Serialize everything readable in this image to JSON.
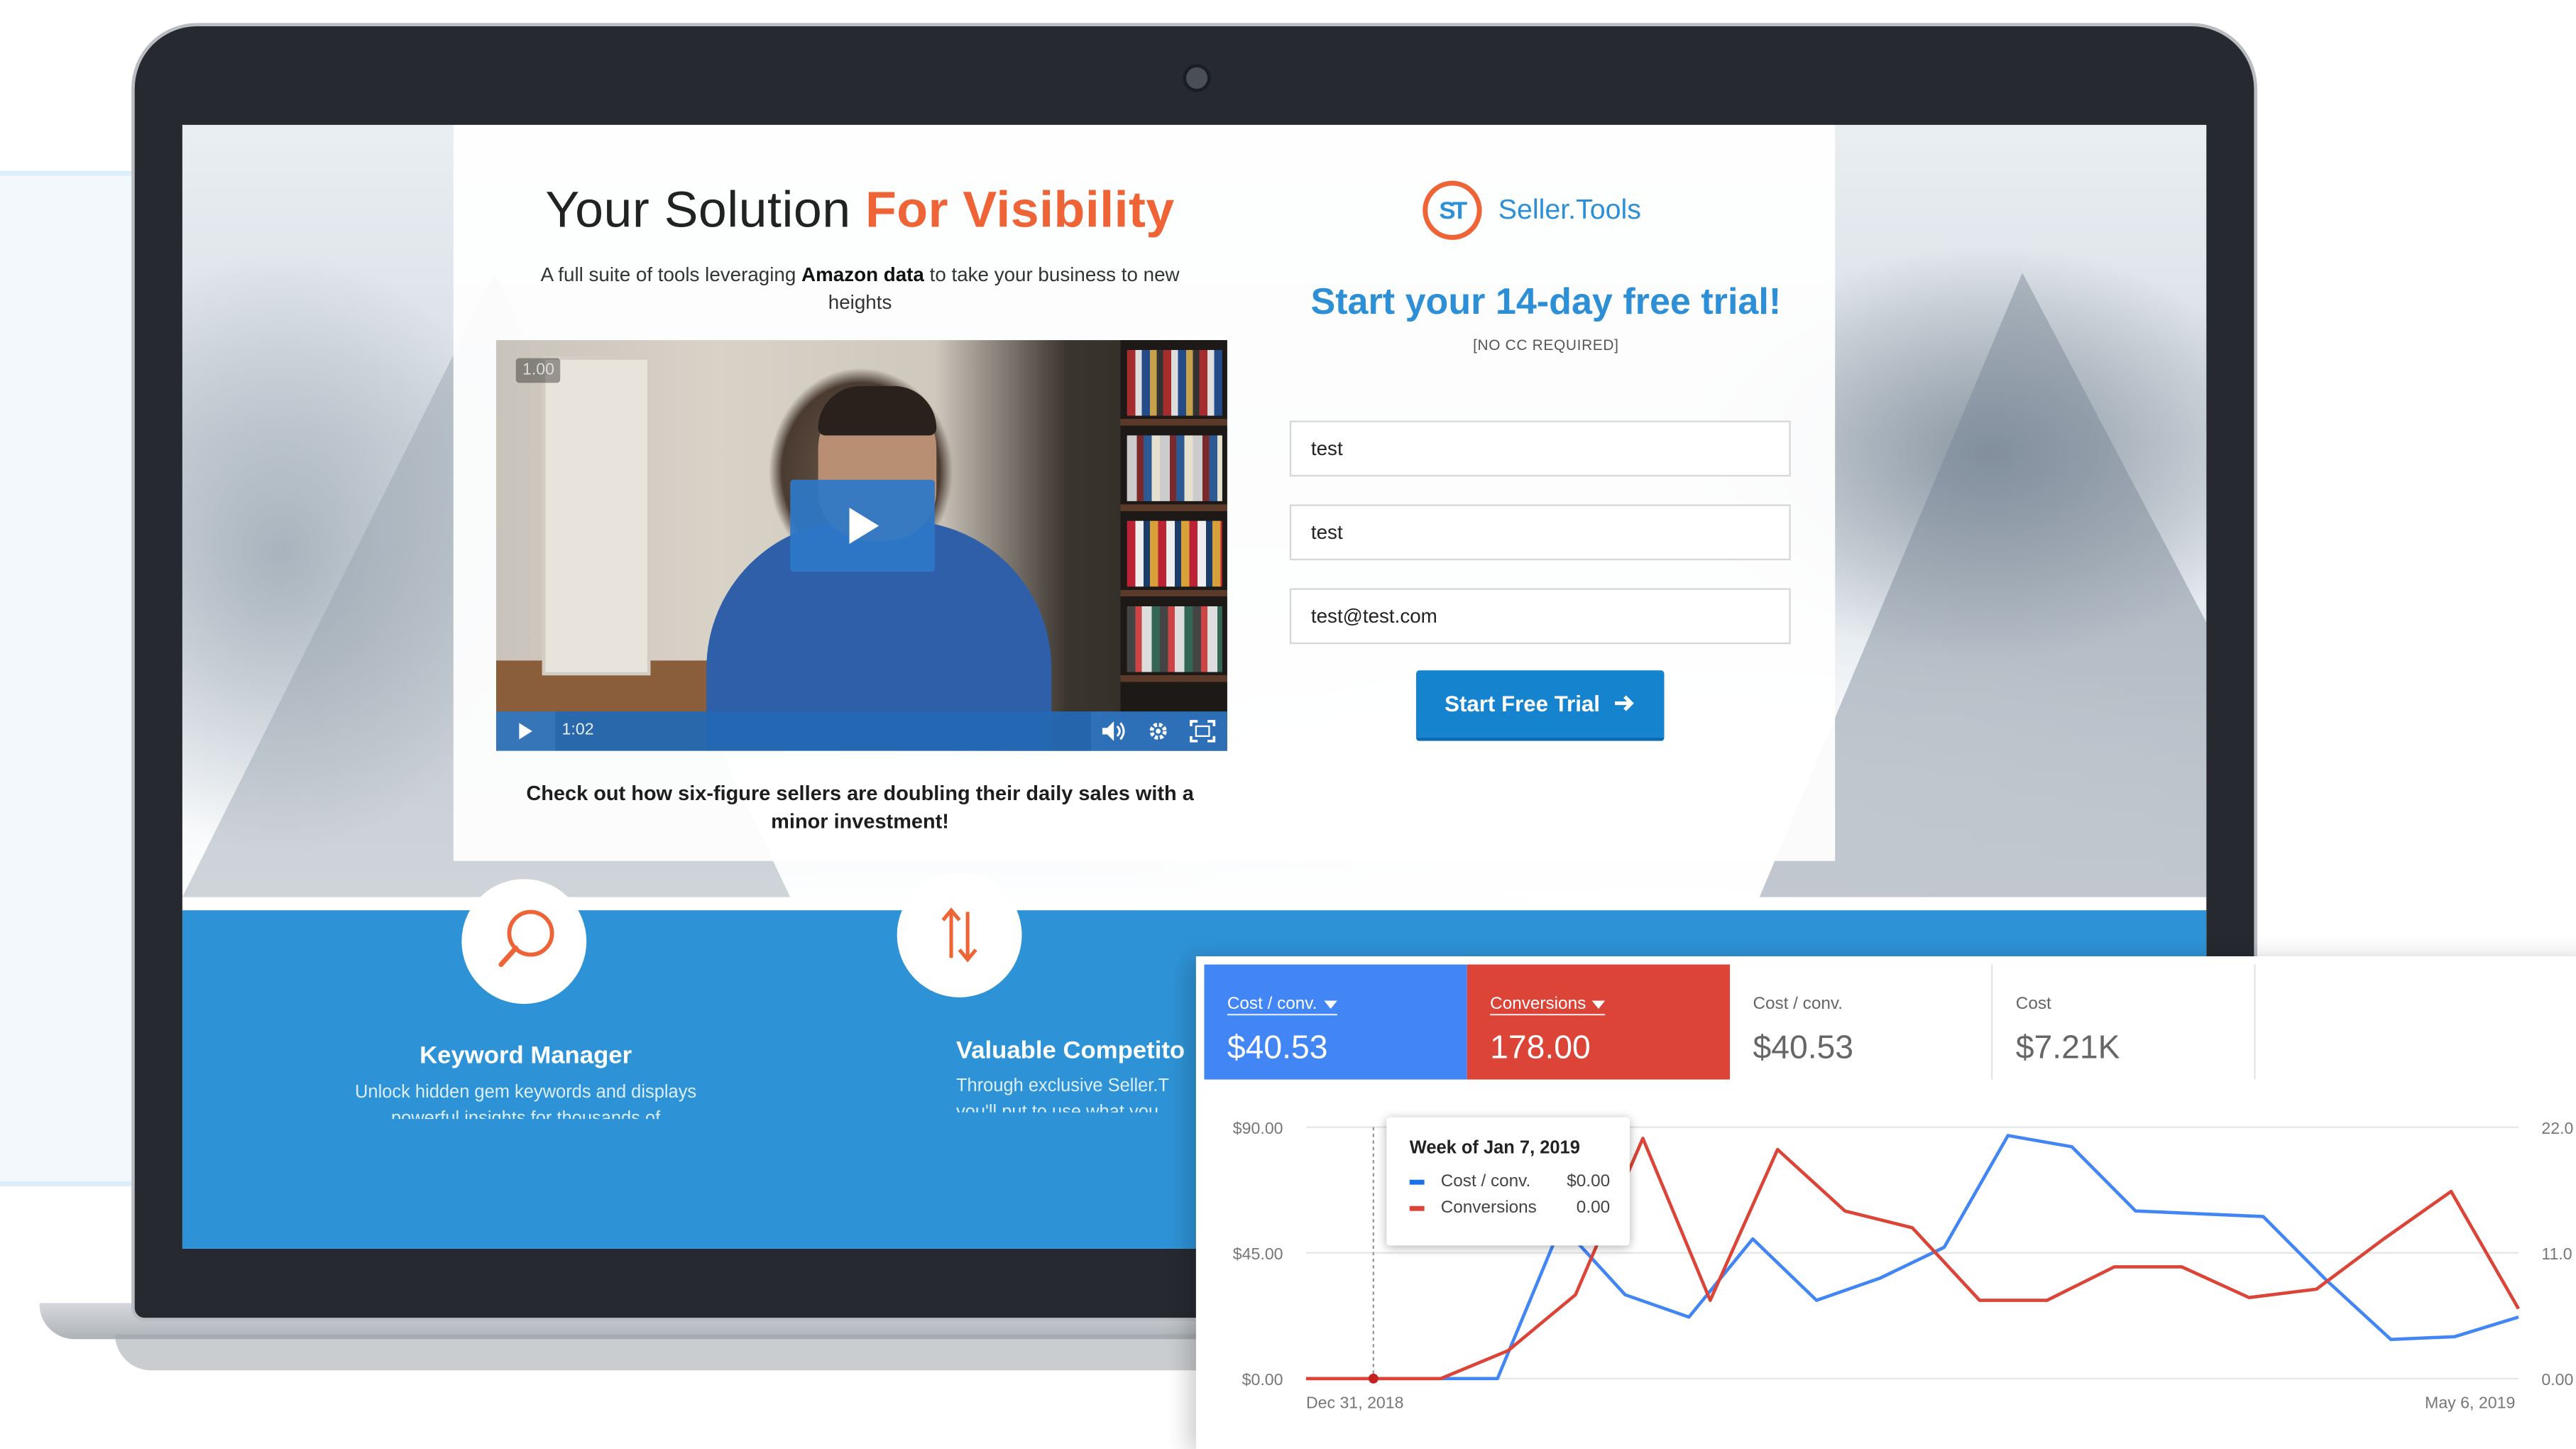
{
  "landing": {
    "headline_plain": "Your Solution ",
    "headline_accent": "For Visibility",
    "subhead_pre": "A full suite of tools leveraging ",
    "subhead_bold": "Amazon data",
    "subhead_post": " to take your business to new heights",
    "video": {
      "rate": "1.00",
      "time": "1:02"
    },
    "caption": "Check out how six-figure sellers are doubling their daily sales with a minor investment!",
    "logo_mark": "ST",
    "logo_text": "Seller.Tools",
    "trial_title": "Start your 14-day free trial!",
    "trial_sub": "[NO CC REQUIRED]",
    "form": {
      "first_name": "test",
      "last_name": "test",
      "email": "test@test.com"
    },
    "cta_label": "Start Free Trial",
    "features": [
      {
        "title": "Keyword Manager",
        "desc": "Unlock hidden gem keywords and displays powerful insights for thousands of"
      },
      {
        "title": "Valuable Competito",
        "desc": "Through exclusive Seller.T you'll put to use what you"
      }
    ]
  },
  "analytics": {
    "tiles": [
      {
        "label": "Cost / conv.",
        "value": "$40.53"
      },
      {
        "label": "Conversions",
        "value": "178.00"
      },
      {
        "label": "Cost / conv.",
        "value": "$40.53"
      },
      {
        "label": "Cost",
        "value": "$7.21K"
      }
    ],
    "tooltip": {
      "title": "Week of Jan 7, 2019",
      "rows": [
        {
          "name": "Cost / conv.",
          "value": "$0.00"
        },
        {
          "name": "Conversions",
          "value": "0.00"
        }
      ]
    }
  },
  "colors": {
    "accent_orange": "#ef6436",
    "brand_blue": "#2d8fd6",
    "series_blue": "#4285f4",
    "series_red": "#db4437"
  },
  "chart_data": {
    "type": "line",
    "x_labels": [
      "Dec 31, 2018",
      "May 6, 2019"
    ],
    "y_left_ticks": [
      "$0.00",
      "$45.00",
      "$90.00"
    ],
    "y_right_ticks": [
      "0.00",
      "11.0",
      "22.0"
    ],
    "ylim_left": [
      0,
      90
    ],
    "ylim_right": [
      0,
      22
    ],
    "grid": true,
    "series": [
      {
        "name": "Cost / conv.",
        "color": "#4285f4",
        "axis": "left",
        "values": [
          0,
          0,
          0,
          0,
          55,
          30,
          22,
          50,
          28,
          36,
          47,
          87,
          83,
          60,
          59,
          58,
          35,
          14,
          15,
          22
        ]
      },
      {
        "name": "Conversions",
        "color": "#db4437",
        "axis": "left",
        "values": [
          0,
          0,
          0,
          10,
          30,
          86,
          28,
          82,
          60,
          54,
          28,
          28,
          40,
          40,
          29,
          32,
          50,
          67,
          25
        ]
      }
    ]
  }
}
